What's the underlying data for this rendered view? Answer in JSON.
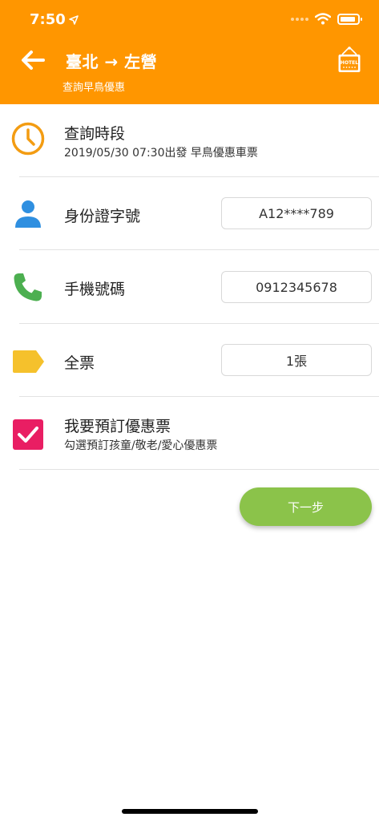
{
  "status_bar": {
    "time": "7:50"
  },
  "header": {
    "route": "臺北 → 左營",
    "subtitle": "查詢早鳥優惠",
    "hotel_sign": "HOTEL"
  },
  "rows": [
    {
      "title": "查詢時段",
      "subtitle": "2019/05/30 07:30出發 早鳥優惠車票"
    },
    {
      "label": "身份證字號",
      "value": "A12****789"
    },
    {
      "label": "手機號碼",
      "value": "0912345678"
    },
    {
      "label": "全票",
      "value": "1張"
    },
    {
      "title": "我要預訂優惠票",
      "subtitle": "勾選預訂孩童/敬老/愛心優惠票"
    }
  ],
  "actions": {
    "next_label": "下一步"
  },
  "colors": {
    "header": "#FF9600",
    "clock": "#F39C12",
    "person": "#2F8FE0",
    "phone": "#4CAF50",
    "tag": "#F5C12C",
    "checkbox": "#E91E63",
    "next_button": "#8BC34A"
  },
  "icons": [
    "arrow-left-icon",
    "hotel-sign-icon",
    "clock-icon",
    "person-icon",
    "phone-icon",
    "tag-icon",
    "checkbox-checked-icon"
  ]
}
